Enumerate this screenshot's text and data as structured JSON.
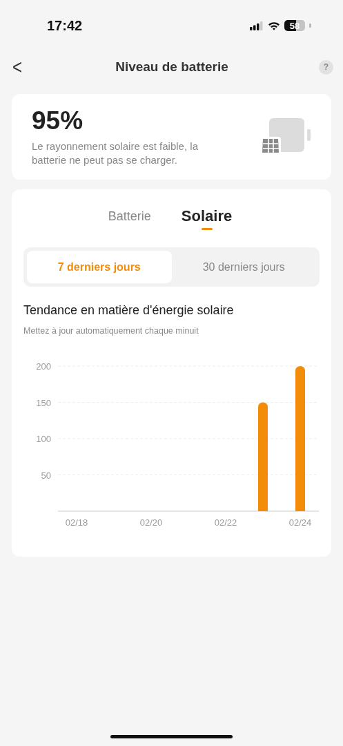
{
  "status_bar": {
    "time": "17:42",
    "battery": "58"
  },
  "nav": {
    "title": "Niveau de batterie",
    "back": "<",
    "help": "?"
  },
  "summary": {
    "percent": "95%",
    "message": "Le rayonnement solaire est faible, la batterie ne peut pas se charger."
  },
  "tabs": [
    {
      "label": "Batterie",
      "selected": false
    },
    {
      "label": "Solaire",
      "selected": true
    }
  ],
  "periods": [
    {
      "label": "7 derniers jours",
      "selected": true
    },
    {
      "label": "30 derniers jours",
      "selected": false
    }
  ],
  "chart": {
    "title": "Tendance en matière d'énergie solaire",
    "subtitle": "Mettez à jour automatiquement chaque minuit",
    "chart_data": {
      "type": "bar",
      "categories": [
        "02/18",
        null,
        "02/20",
        null,
        "02/22",
        null,
        "02/24"
      ],
      "series": [
        {
          "color": "#f28c0a",
          "values": [
            0,
            0,
            0,
            0,
            0,
            150,
            200
          ]
        }
      ],
      "ylim": [
        0,
        200
      ],
      "yticks": [
        50,
        100,
        150,
        200
      ],
      "grid": true
    }
  }
}
